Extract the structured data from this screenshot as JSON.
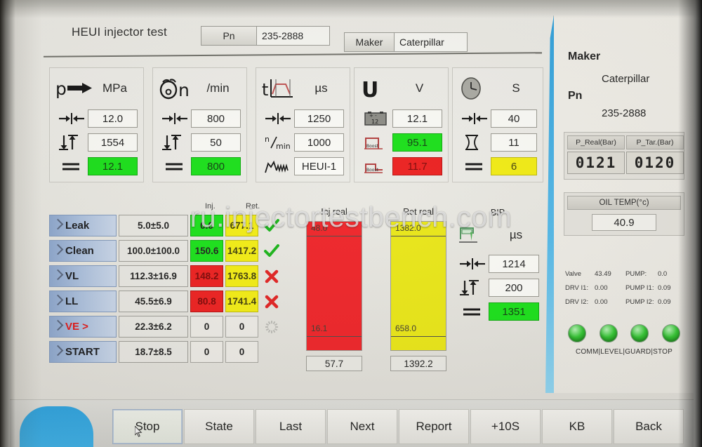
{
  "header": {
    "title": "HEUI injector test",
    "pn_label": "Pn",
    "pn_value": "235-2888",
    "maker_label": "Maker",
    "maker_value": "Caterpillar"
  },
  "params": [
    {
      "id": "p",
      "symbol": "p",
      "symbol_icon": "pressure-arrow-icon",
      "unit": "MPa",
      "rows": [
        {
          "icon": "width-between-arrows-icon",
          "value": "12.0",
          "state": "plain"
        },
        {
          "icon": "vertical-range-icon",
          "value": "1554",
          "state": "plain"
        },
        {
          "icon": "equals-icon",
          "value": "12.1",
          "state": "green"
        }
      ]
    },
    {
      "id": "n",
      "symbol": "n",
      "symbol_icon": "rotation-speed-icon",
      "unit": "/min",
      "rows": [
        {
          "icon": "width-between-arrows-icon",
          "value": "800",
          "state": "plain"
        },
        {
          "icon": "vertical-range-icon",
          "value": "50",
          "state": "plain"
        },
        {
          "icon": "equals-icon",
          "value": "800",
          "state": "green"
        }
      ]
    },
    {
      "id": "t",
      "symbol": "t",
      "symbol_icon": "pulse-waveform-icon",
      "unit": "µs",
      "rows": [
        {
          "icon": "width-between-arrows-icon",
          "value": "1250",
          "state": "plain"
        },
        {
          "icon": "n-per-min-icon",
          "value": "1000",
          "state": "plain"
        },
        {
          "icon": "signal-shape-icon",
          "value": "HEUI-1",
          "state": "plain"
        }
      ]
    },
    {
      "id": "u",
      "symbol": "U",
      "symbol_icon": "voltage-icon",
      "unit": "V",
      "rows": [
        {
          "icon": "battery-12-icon",
          "value": "12.1",
          "state": "plain"
        },
        {
          "icon": "boost-step-icon",
          "value": "95.1",
          "state": "green"
        },
        {
          "icon": "boost-step-icon",
          "value": "11.7",
          "state": "red"
        }
      ]
    },
    {
      "id": "s",
      "symbol": "",
      "symbol_icon": "clock-icon",
      "unit": "S",
      "rows": [
        {
          "icon": "width-between-arrows-icon",
          "value": "40",
          "state": "plain"
        },
        {
          "icon": "hourglass-icon",
          "value": "11",
          "state": "plain"
        },
        {
          "icon": "equals-icon",
          "value": "6",
          "state": "yellow"
        }
      ]
    }
  ],
  "table": {
    "col_inj": "Inj.",
    "col_ret": "Ret.",
    "rows": [
      {
        "name": "Leak",
        "alert": false,
        "spec": "5.0±5.0",
        "inj": "0.0",
        "inj_state": "green",
        "ret": "677.1",
        "ret_state": "yellow",
        "status": "pass"
      },
      {
        "name": "Clean",
        "alert": false,
        "spec": "100.0±100.0",
        "inj": "150.6",
        "inj_state": "green",
        "ret": "1417.2",
        "ret_state": "yellow",
        "status": "pass"
      },
      {
        "name": "VL",
        "alert": false,
        "spec": "112.3±16.9",
        "inj": "148.2",
        "inj_state": "red",
        "ret": "1763.8",
        "ret_state": "yellow",
        "status": "fail"
      },
      {
        "name": "LL",
        "alert": false,
        "spec": "45.5±6.9",
        "inj": "80.8",
        "inj_state": "red",
        "ret": "1741.4",
        "ret_state": "yellow",
        "status": "fail"
      },
      {
        "name": "VE >",
        "alert": true,
        "spec": "22.3±6.2",
        "inj": "0",
        "inj_state": "plain",
        "ret": "0",
        "ret_state": "plain",
        "status": "busy"
      },
      {
        "name": "START",
        "alert": false,
        "spec": "18.7±8.5",
        "inj": "0",
        "inj_state": "plain",
        "ret": "0",
        "ret_state": "plain",
        "status": "none"
      }
    ]
  },
  "bars": [
    {
      "id": "inj",
      "label": "Inj real",
      "color": "red",
      "upper": "48.0",
      "lower": "16.1",
      "value": "57.7"
    },
    {
      "id": "ret",
      "label": "Ret real",
      "color": "yellow",
      "upper": "1382.0",
      "lower": "658.0",
      "value": "1392.2"
    }
  ],
  "bip": {
    "title": "BIP",
    "unit": "µs",
    "symbol_icon": "bip-needle-icon",
    "rows": [
      {
        "icon": "width-between-arrows-icon",
        "value": "1214",
        "state": "plain"
      },
      {
        "icon": "vertical-range-icon",
        "value": "200",
        "state": "plain"
      },
      {
        "icon": "equals-icon",
        "value": "1351",
        "state": "green"
      }
    ]
  },
  "sidebar": {
    "maker_label": "Maker",
    "maker_value": "Caterpillar",
    "pn_label": "Pn",
    "pn_value": "235-2888",
    "p_real_label": "P_Real(Bar)",
    "p_real_value": "0121",
    "p_tar_label": "P_Tar.(Bar)",
    "p_tar_value": "0120",
    "oil_temp_label": "OIL TEMP(°c)",
    "oil_temp_value": "40.9",
    "stats": [
      {
        "k1": "Valve",
        "v1": "43.49",
        "k2": "PUMP:",
        "v2": "0.0"
      },
      {
        "k1": "DRV I1:",
        "v1": "0.00",
        "k2": "PUMP I1:",
        "v2": "0.09"
      },
      {
        "k1": "DRV I2:",
        "v1": "0.00",
        "k2": "PUMP I2:",
        "v2": "0.09"
      }
    ],
    "leds": [
      "led-comm",
      "led-level",
      "led-guard",
      "led-stop"
    ],
    "leds_label": "COMM|LEVEL|GUARD|STOP"
  },
  "footer": {
    "buttons": [
      {
        "label": "Stop",
        "active": true
      },
      {
        "label": "State",
        "active": false
      },
      {
        "label": "Last",
        "active": false
      },
      {
        "label": "Next",
        "active": false
      },
      {
        "label": "Report",
        "active": false
      },
      {
        "label": "+10S",
        "active": false
      },
      {
        "label": "KB",
        "active": false
      },
      {
        "label": "Back",
        "active": false
      }
    ]
  },
  "watermark": "ru.injectortestbench.com",
  "colors": {
    "green": "#16e016",
    "red": "#ec1c1c",
    "yellow": "#f2ec10",
    "accent_blue": "#2da0dd"
  }
}
